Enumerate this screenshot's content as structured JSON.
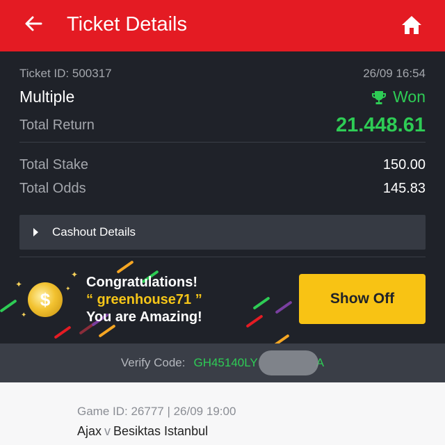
{
  "header": {
    "title": "Ticket Details"
  },
  "ticket": {
    "id_text": "Ticket ID: 500317",
    "date": "26/09 16:54",
    "type": "Multiple",
    "status": "Won",
    "total_return_label": "Total Return",
    "total_return": "21.448.61",
    "total_stake_label": "Total Stake",
    "total_stake": "150.00",
    "total_odds_label": "Total Odds",
    "total_odds": "145.83"
  },
  "cashout": {
    "label": "Cashout Details"
  },
  "promo": {
    "line1": "Congratulations!",
    "line2": "“ greenhouse71 ”",
    "line3": "You are Amazing!",
    "button": "Show Off"
  },
  "verify": {
    "label": "Verify Code:",
    "code": "GH45140LY",
    "code_tail": "A"
  },
  "game": {
    "id_text": "Game ID: 26777 | 26/09 19:00",
    "home": "Ajax",
    "vs": "v",
    "away": "Besiktas Istanbul"
  },
  "colors": {
    "brand": "#e41b23",
    "win": "#2ecc55",
    "accent": "#f8c314"
  }
}
